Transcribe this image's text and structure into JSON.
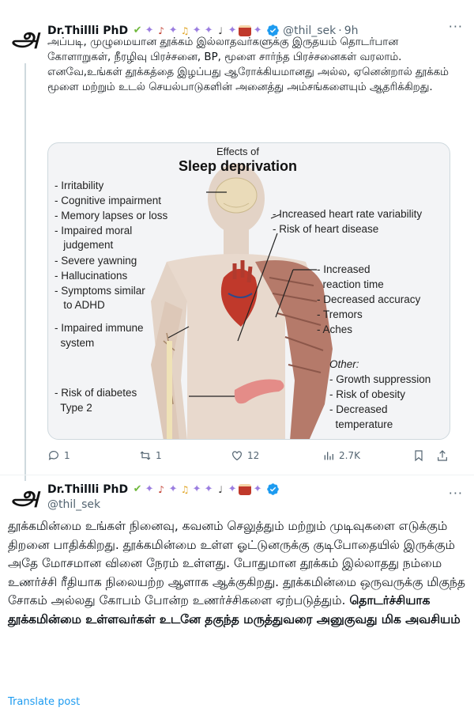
{
  "tweet1": {
    "author_name": "Dr.Thillli PhD",
    "handle": "@thil_sek",
    "separator": "·",
    "time": "9h",
    "text": "அப்படி, முழுமையான தூக்கம் இல்லாதவர்களுக்கு இருதயம் தொடர்பான கோளாறுகள், நீரழிவு பிரச்சனை, BP, மூளை சார்ந்த பிரச்சனைகள் வரலாம். எனவே,உங்கள் தூக்கத்தை இழப்பது ஆரோக்கியமானது அல்ல, ஏனென்றால் தூக்கம் மூளை மற்றும் உடல் செயல்பாடுகளின் அனைத்து அம்சங்களையும் ஆதரிக்கிறது.",
    "figure": {
      "title_small": "Effects of",
      "title_large": "Sleep deprivation",
      "left_labels": [
        "- Irritability",
        "- Cognitive impairment",
        "- Memory lapses or loss",
        "- Impaired moral",
        "   judgement",
        "- Severe yawning",
        "- Hallucinations",
        "- Symptoms similar",
        "   to ADHD"
      ],
      "immune_labels": [
        "- Impaired immune",
        "  system"
      ],
      "diabetes_labels": [
        "- Risk of diabetes",
        "  Type 2"
      ],
      "heart_labels": [
        "- Increased heart rate variability",
        "- Risk of heart disease"
      ],
      "muscle_labels": [
        "- Increased",
        "  reaction time",
        "- Decreased accuracy",
        "- Tremors",
        "- Aches"
      ],
      "other_heading": "Other:",
      "other_labels": [
        "- Growth suppression",
        "- Risk of obesity",
        "- Decreased",
        "  temperature"
      ]
    },
    "replies": "1",
    "reposts": "1",
    "likes": "12",
    "views": "2.7K"
  },
  "tweet2": {
    "author_name": "Dr.Thillli PhD",
    "handle": "@thil_sek",
    "text": "தூக்கமின்மை உங்கள் நினைவு, கவனம் செலுத்தும் மற்றும் முடிவுகளை எடுக்கும் திறனை பாதிக்கிறது. தூக்கமின்மை உள்ள ஓட்டுனருக்கு குடிபோதையில் இருக்கும் அதே மோசமான வினை நேரம் உள்ளது. போதுமான தூக்கம் இல்லாதது நம்மை உணர்ச்சி ரீதியாக நிலையற்ற ஆளாக ஆக்குகிறது. தூக்கமின்மை ஒருவருக்கு மிகுந்த சோகம் அல்லது கோபம் போன்ற உணர்ச்சிகளை ஏற்படுத்தும்.",
    "text_bold": "தொடர்ச்சியாக தூக்கமின்மை உள்ளவர்கள் உடனே தகுந்த மருத்துவரை அனுகுவது மிக அவசியம்",
    "translate_label": "Translate post"
  },
  "avatar_glyph": "அ",
  "emoji_icons": [
    "check-icon",
    "sparkle-icon",
    "guitar-icon",
    "sparkle-icon",
    "saxophone-icon",
    "sparkle-icon",
    "sparkle-icon",
    "microphone-icon",
    "sparkle-icon",
    "drum-icon",
    "sparkle-icon"
  ],
  "colors": {
    "accent": "#1d9bf0",
    "muted": "#536471",
    "border": "#cfd9de"
  }
}
